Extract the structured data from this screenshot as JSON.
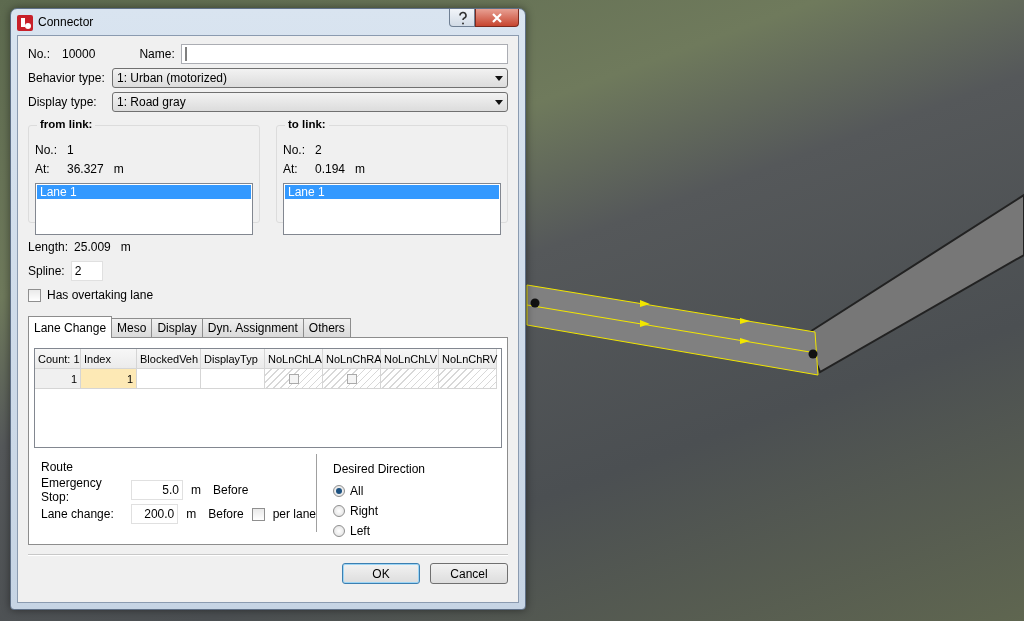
{
  "window": {
    "title": "Connector"
  },
  "number": {
    "label": "No.:",
    "value": "10000"
  },
  "name": {
    "label": "Name:"
  },
  "behavior_type": {
    "label": "Behavior type:",
    "value": "1: Urban (motorized)"
  },
  "display_type": {
    "label": "Display type:",
    "value": "1: Road gray"
  },
  "from_link": {
    "title": "from link:",
    "number_label": "No.:",
    "number": "1",
    "at_label": "At:",
    "at": "36.327",
    "unit": "m",
    "lanes": [
      {
        "label": "Lane 1",
        "selected": true
      }
    ]
  },
  "to_link": {
    "title": "to link:",
    "number_label": "No.:",
    "number": "2",
    "at_label": "At:",
    "at": "0.194",
    "unit": "m",
    "lanes": [
      {
        "label": "Lane 1",
        "selected": true
      }
    ]
  },
  "length": {
    "label": "Length:",
    "value": "25.009",
    "unit": "m"
  },
  "spline": {
    "label": "Spline:",
    "value": "2"
  },
  "overtaking_lane": {
    "label": "Has overtaking lane",
    "checked": false
  },
  "tabs": [
    {
      "label": "Lane Change",
      "selected": true
    },
    {
      "label": "Meso",
      "selected": false
    },
    {
      "label": "Display",
      "selected": false
    },
    {
      "label": "Dyn. Assignment",
      "selected": false
    },
    {
      "label": "Others",
      "selected": false
    }
  ],
  "table": {
    "columns": [
      "Count: 1",
      "Index",
      "BlockedVeh",
      "DisplayTyp",
      "NoLnChLA",
      "NoLnChRA",
      "NoLnChLV",
      "NoLnChRV"
    ],
    "rows": [
      {
        "cells": [
          {
            "kind": "rowheader",
            "text": "1"
          },
          {
            "kind": "text",
            "text": "1",
            "selected": true
          },
          {
            "kind": "text",
            "selected": false
          },
          {
            "kind": "text",
            "selected": false
          },
          {
            "kind": "checkbox",
            "checked": false
          },
          {
            "kind": "checkbox",
            "checked": false
          },
          {
            "kind": "hatched"
          },
          {
            "kind": "hatched"
          }
        ]
      }
    ]
  },
  "route": {
    "title": "Route",
    "emergency_stop": {
      "label": "Emergency Stop:",
      "value": "5.0",
      "unit": "m",
      "suffix": "Before"
    },
    "lane_change": {
      "label": "Lane change:",
      "value": "200.0",
      "unit": "m",
      "suffix": "Before",
      "per_lane": {
        "label": "per lane",
        "checked": false
      }
    }
  },
  "desired_direction": {
    "title": "Desired Direction",
    "options": [
      {
        "label": "All",
        "selected": true
      },
      {
        "label": "Right",
        "selected": false
      },
      {
        "label": "Left",
        "selected": false
      }
    ]
  },
  "buttons": [
    {
      "label": "OK",
      "default": true
    },
    {
      "label": "Cancel",
      "default": false
    }
  ]
}
